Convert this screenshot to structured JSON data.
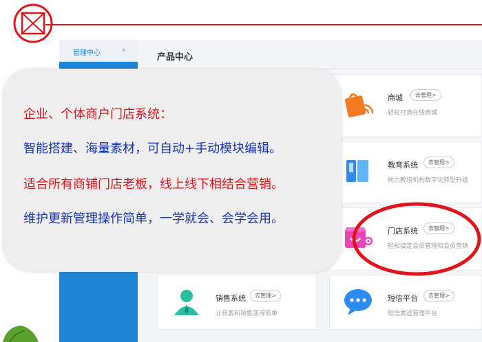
{
  "sidebar": {
    "item_label": "管理中心"
  },
  "main": {
    "title": "产品中心"
  },
  "overlay": {
    "line1": "企业、个体商户门店系统：",
    "line2": "智能搭建、海量素材，可自动+手动模块编辑。",
    "line3": "适合所有商铺门店老板，线上线下相结合营销。",
    "line4": "维护更新管理操作简单，一学就会、会学会用。"
  },
  "products": [
    {
      "name": "商城",
      "button": "去管理>",
      "desc": "轻松打造在线商城",
      "icon": "shopping-bag-icon"
    },
    {
      "name": "教育系统",
      "button": "去管理>",
      "desc": "助力教培机构数字化转型升级",
      "icon": "education-book-icon"
    },
    {
      "name": "门店系统",
      "button": "去管理>",
      "desc": "轻松搞定会员管理和会员营销",
      "icon": "store-icon"
    },
    {
      "name": "销售系统",
      "button": "去管理>",
      "desc": "让获客和销售变得简单",
      "icon": "sales-person-icon"
    },
    {
      "name": "短信平台",
      "button": "去管理>",
      "desc": "短信发送管理平台",
      "icon": "chat-bubble-icon"
    }
  ],
  "colors": {
    "accent_red": "#e0141b",
    "sidebar_blue": "#1f86d6",
    "text_blue": "#1a36b0"
  }
}
